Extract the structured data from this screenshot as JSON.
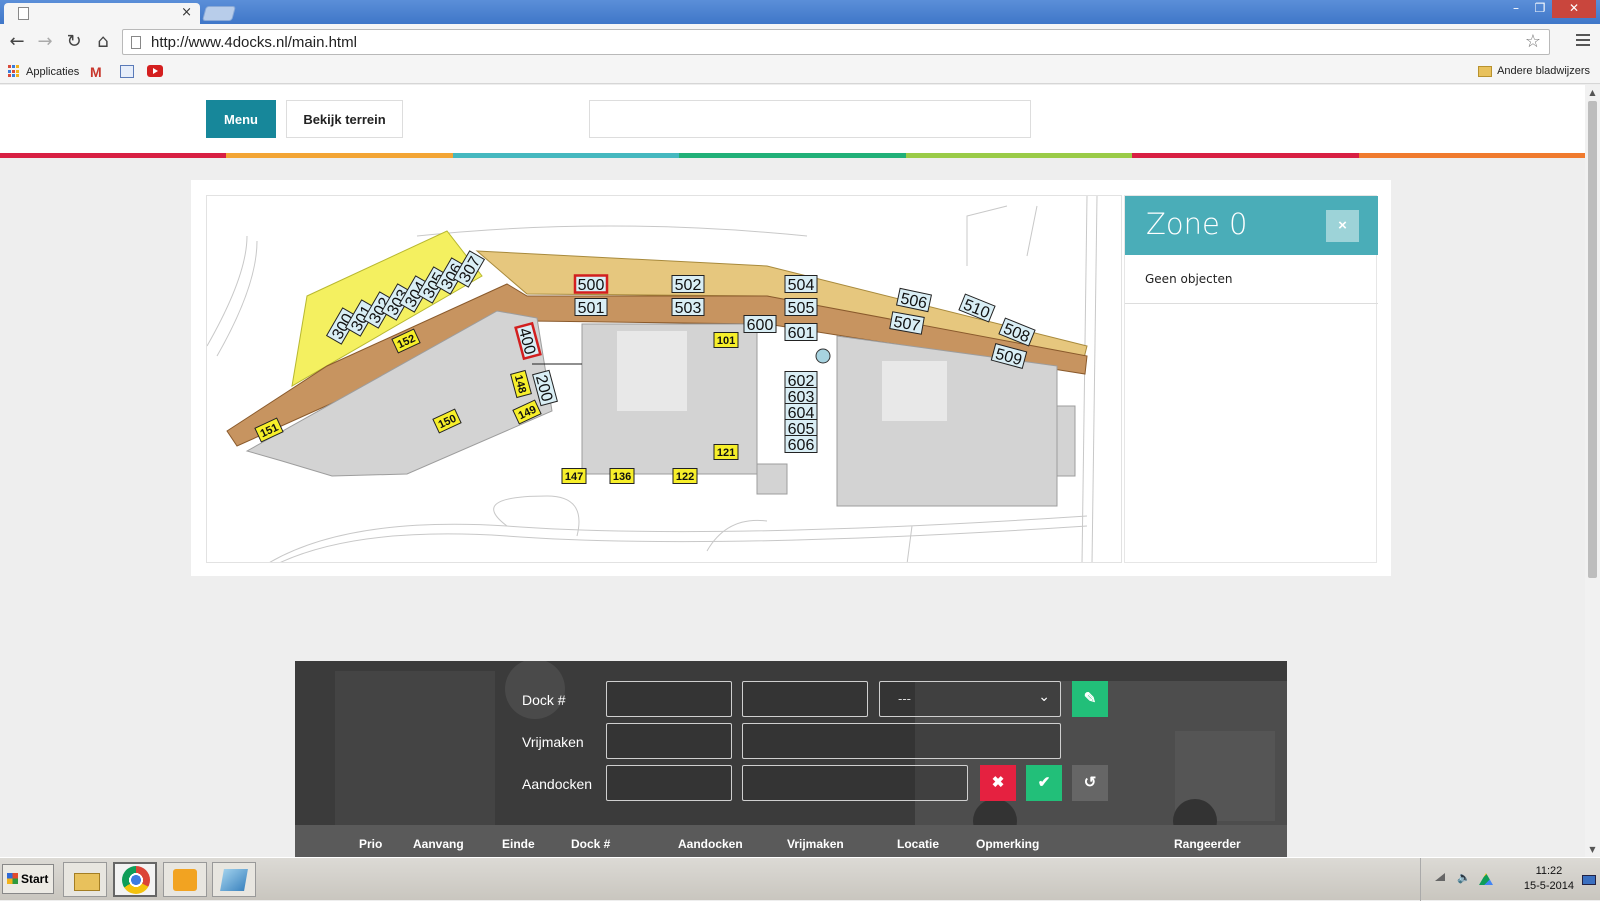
{
  "browser": {
    "tab_close": "×",
    "url": "http://www.4docks.nl/main.html",
    "bookmarks": {
      "apps_label": "Applicaties",
      "gmail_label": "M",
      "other_label": "Andere bladwijzers"
    }
  },
  "header": {
    "menu_label": "Menu",
    "terrain_label": "Bekijk terrein",
    "search_value": ""
  },
  "stripe_colors": [
    "#d81f43",
    "#f3a535",
    "#45b8bf",
    "#21b078",
    "#9acb47",
    "#d81f43",
    "#f07b2e"
  ],
  "map": {
    "docks_white": [
      "500",
      "502",
      "504",
      "501",
      "503",
      "505",
      "600",
      "601",
      "506",
      "507",
      "510",
      "508",
      "509",
      "400",
      "200",
      "602",
      "603",
      "604",
      "605",
      "606",
      "300",
      "301",
      "302",
      "303",
      "304",
      "305",
      "306",
      "307"
    ],
    "docks_yellow": [
      "152",
      "101",
      "148",
      "149",
      "150",
      "151",
      "121",
      "147",
      "136",
      "122"
    ],
    "highlighted": [
      "500",
      "400"
    ]
  },
  "zone": {
    "title": "Zone 0",
    "close_icon": "×",
    "empty_text": "Geen objecten"
  },
  "dock_form": {
    "dock_label": "Dock #",
    "release_label": "Vrijmaken",
    "dock_in_label": "Aandocken",
    "select_value": "---",
    "fields": {
      "dock_no": "",
      "dock_extra": "",
      "release_a": "",
      "release_b": "",
      "dock_in_a": "",
      "dock_in_b": ""
    }
  },
  "table": {
    "columns": [
      "Prio",
      "Aanvang",
      "Einde",
      "Dock #",
      "Aandocken",
      "Vrijmaken",
      "Locatie",
      "Opmerking",
      "Rangeerder"
    ]
  },
  "taskbar": {
    "start_label": "Start",
    "time": "11:22",
    "date": "15-5-2014"
  }
}
